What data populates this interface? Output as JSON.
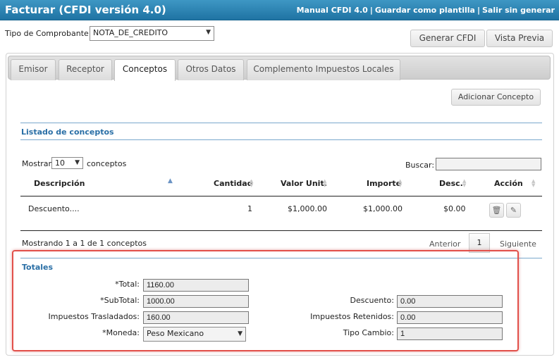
{
  "header": {
    "title": "Facturar (CFDI versión 4.0)",
    "links": [
      "Manual CFDI 4.0",
      "Guardar como plantilla",
      "Salir sin generar"
    ],
    "separator": "|"
  },
  "tipo_comprobante": {
    "label": "Tipo de Comprobante:",
    "value": "NOTA_DE_CREDITO"
  },
  "actions": {
    "generar": "Generar CFDI",
    "vista_previa": "Vista Previa"
  },
  "tabs": [
    {
      "label": "Emisor",
      "active": false
    },
    {
      "label": "Receptor",
      "active": false
    },
    {
      "label": "Conceptos",
      "active": true
    },
    {
      "label": "Otros Datos",
      "active": false
    },
    {
      "label": "Complemento Impuestos Locales",
      "active": false
    }
  ],
  "conceptos": {
    "add_button": "Adicionar Concepto",
    "section_title": "Listado de conceptos",
    "show_label": "Mostrar",
    "page_size": "10",
    "show_suffix": "conceptos",
    "search_label": "Buscar:",
    "search_value": "",
    "columns": [
      "Descripción",
      "Cantidad",
      "Valor Unit.",
      "Importe",
      "Desc.",
      "Acción"
    ],
    "rows": [
      {
        "descripcion": "Descuento....",
        "cantidad": "1",
        "valor_unit": "$1,000.00",
        "importe": "$1,000.00",
        "desc": "$0.00",
        "actions": [
          "trash-icon",
          "pencil-icon"
        ]
      }
    ],
    "info": "Mostrando 1 a 1 de 1 conceptos",
    "pagination": {
      "previous": "Anterior",
      "current": "1",
      "next": "Siguiente"
    }
  },
  "totales": {
    "title": "Totales",
    "total": {
      "label": "*Total:",
      "value": "1160.00"
    },
    "subtotal": {
      "label": "*SubTotal:",
      "value": "1000.00"
    },
    "impuestos_trasladados": {
      "label": "Impuestos Trasladados:",
      "value": "160.00"
    },
    "moneda": {
      "label": "*Moneda:",
      "value": "Peso Mexicano"
    },
    "descuento": {
      "label": "Descuento:",
      "value": "0.00"
    },
    "impuestos_retenidos": {
      "label": "Impuestos Retenidos:",
      "value": "0.00"
    },
    "tipo_cambio": {
      "label": "Tipo Cambio:",
      "value": "1"
    }
  },
  "colors": {
    "header_bg": "#2d86b8",
    "section_title": "#2a6fa6",
    "highlight_border": "#e2504a"
  }
}
